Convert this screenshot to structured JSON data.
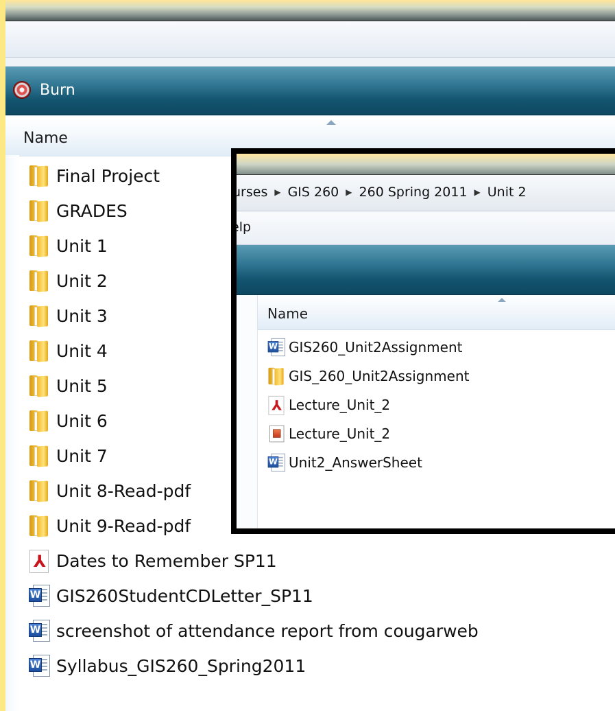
{
  "main": {
    "address_fragment": "›",
    "toolbar": {
      "burn_label": "Burn"
    },
    "column_header": {
      "name": "Name"
    },
    "files": [
      {
        "name": "Final Project",
        "type": "folder"
      },
      {
        "name": "GRADES",
        "type": "folder"
      },
      {
        "name": "Unit 1",
        "type": "folder"
      },
      {
        "name": "Unit 2",
        "type": "folder"
      },
      {
        "name": "Unit 3",
        "type": "folder"
      },
      {
        "name": "Unit 4",
        "type": "folder"
      },
      {
        "name": "Unit 5",
        "type": "folder"
      },
      {
        "name": "Unit 6",
        "type": "folder"
      },
      {
        "name": "Unit 7",
        "type": "folder"
      },
      {
        "name": "Unit 8-Read-pdf",
        "type": "folder"
      },
      {
        "name": "Unit 9-Read-pdf",
        "type": "folder"
      },
      {
        "name": "Dates to Remember SP11",
        "type": "pdf"
      },
      {
        "name": "GIS260StudentCDLetter_SP11",
        "type": "word"
      },
      {
        "name": "screenshot of attendance report from cougarweb",
        "type": "word"
      },
      {
        "name": "Syllabus_GIS260_Spring2011",
        "type": "word"
      }
    ]
  },
  "inset": {
    "breadcrumb": [
      "urses",
      "GIS 260",
      "260 Spring 2011",
      "Unit 2"
    ],
    "menu": {
      "help_fragment": "elp"
    },
    "column_header": {
      "name": "Name"
    },
    "files": [
      {
        "name": "GIS260_Unit2Assignment",
        "type": "word"
      },
      {
        "name": "GIS_260_Unit2Assignment",
        "type": "zip-folder"
      },
      {
        "name": "Lecture_Unit_2",
        "type": "pdf"
      },
      {
        "name": "Lecture_Unit_2",
        "type": "powerpoint"
      },
      {
        "name": "Unit2_AnswerSheet",
        "type": "word"
      }
    ]
  },
  "icons": {
    "folder": "folder-icon",
    "pdf": "pdf-icon",
    "word": "word-doc-icon",
    "powerpoint": "powerpoint-icon",
    "burn": "burn-disc-icon"
  }
}
